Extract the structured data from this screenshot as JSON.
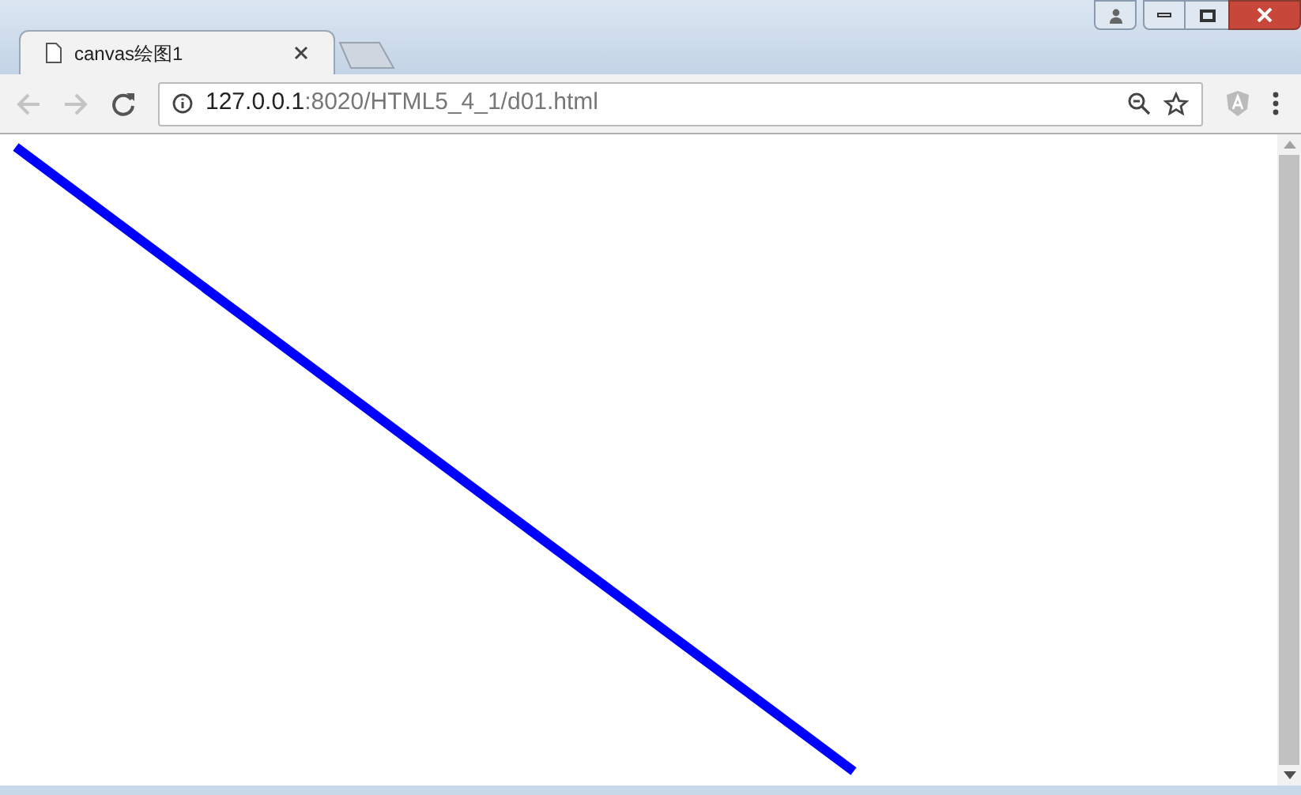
{
  "tabs": [
    {
      "title": "canvas绘图1",
      "selected": true
    }
  ],
  "address_bar": {
    "host": "127.0.0.1",
    "path": ":8020/HTML5_4_1/d01.html"
  },
  "nav": {
    "back_disabled": true,
    "forward_disabled": true
  }
}
